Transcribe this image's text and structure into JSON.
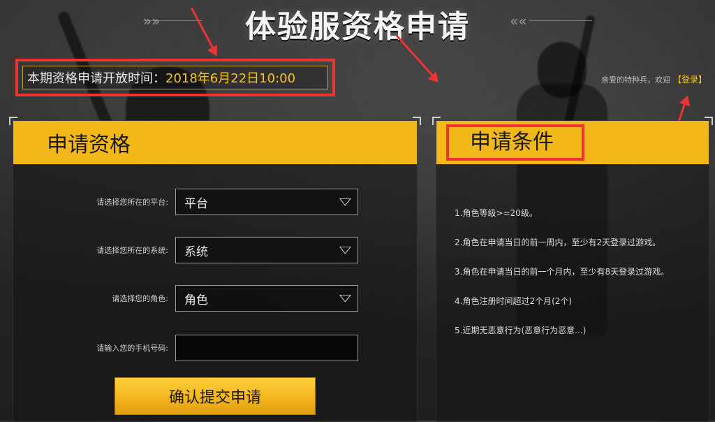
{
  "header": {
    "title": "体验服资格申请",
    "arrows_left": "»»",
    "arrows_right": "««"
  },
  "open_time": {
    "label": "本期资格申请开放时间：",
    "value": "2018年6月22日10:00"
  },
  "greeting": {
    "text": "亲爱的特种兵，欢迎",
    "login_label": "【登录】"
  },
  "apply_panel": {
    "title": "申请资格",
    "fields": {
      "platform_label": "请选择您所在的平台:",
      "platform_value": "平台",
      "system_label": "请选择您所在的系统:",
      "system_value": "系统",
      "role_label": "请选择您的角色:",
      "role_value": "角色",
      "phone_label": "请输入您的手机号码:",
      "phone_value": ""
    },
    "submit_label": "确认提交申请"
  },
  "conditions_panel": {
    "title": "申请条件",
    "items": [
      "1.角色等级>=20级。",
      "2.角色在申请当日的前一周内，至少有2天登录过游戏。",
      "3.角色在申请当日的前一个月内，至少有8天登录过游戏。",
      "4.角色注册时间超过2个月(2个)",
      "5.近期无恶意行为(恶意行为恶意...)"
    ]
  },
  "colors": {
    "accent": "#f2b81a",
    "annotation": "#e33333",
    "highlight_text": "#f7c61c"
  }
}
